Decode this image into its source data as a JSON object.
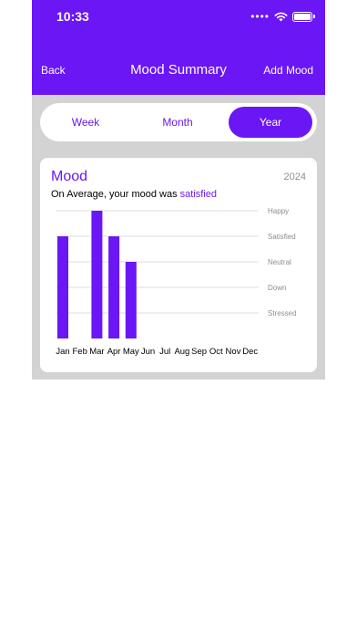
{
  "status": {
    "time": "10:33"
  },
  "nav": {
    "back": "Back",
    "title": "Mood Summary",
    "add": "Add Mood"
  },
  "segments": [
    "Week",
    "Month",
    "Year"
  ],
  "selected_segment": "Year",
  "card": {
    "title": "Mood",
    "year": "2024",
    "average_prefix": "On Average, your mood was",
    "average_value": "satisfied"
  },
  "colors": {
    "accent": "#6a16f5",
    "background": "#d3d3d3",
    "card": "#ffffff",
    "gridline": "#d0d0d0",
    "label": "#8e8e93"
  },
  "chart_data": {
    "type": "bar",
    "categories": [
      "Jan",
      "Feb",
      "Mar",
      "Apr",
      "May",
      "Jun",
      "Jul",
      "Aug",
      "Sep",
      "Oct",
      "Nov",
      "Dec"
    ],
    "y_levels": [
      "Happy",
      "Satisfied",
      "Neutral",
      "Down",
      "Stressed"
    ],
    "values": [
      4,
      null,
      5,
      4,
      3,
      null,
      null,
      null,
      null,
      null,
      null,
      null
    ],
    "ylim": [
      0,
      5
    ]
  }
}
